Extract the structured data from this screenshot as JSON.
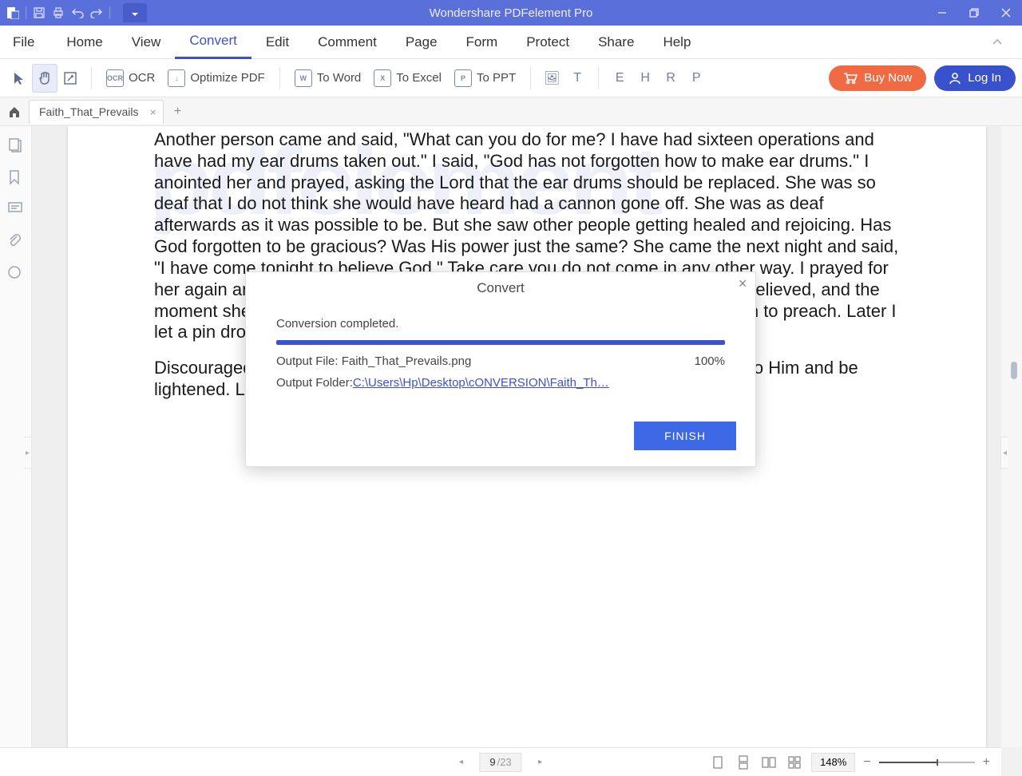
{
  "titlebar": {
    "title": "Wondershare PDFelement Pro"
  },
  "menu": {
    "file": "File",
    "items": [
      "Home",
      "View",
      "Convert",
      "Edit",
      "Comment",
      "Page",
      "Form",
      "Protect",
      "Share",
      "Help"
    ],
    "active_index": 2
  },
  "ribbon": {
    "ocr": "OCR",
    "optimize": "Optimize PDF",
    "to_word": "To Word",
    "to_excel": "To Excel",
    "to_ppt": "To PPT",
    "buy_now": "Buy Now",
    "log_in": "Log In"
  },
  "tabs": {
    "document_name": "Faith_That_Prevails"
  },
  "page_text": {
    "p1": "Another person came and said, \"What can you do for me? I have had sixteen operations and have had my ear drums taken out.\" I said, \"God has not forgotten how to make ear drums.\" I anointed her and prayed, asking the Lord that the ear drums should be replaced. She was so deaf that I do not think she would have heard had a cannon gone off. She was as deaf afterwards as it was possible to be. But she saw other people getting healed and rejoicing. Has God forgotten to be gracious? Was His power just the same? She came the next night and said, \"I have come tonight to believe God.\" Take care you do not come in any other way. I prayed for her again and commanded her ears to be loosed in the name of Jesus. She believed, and the moment she believed she heard, she ran and jumped upon a chair and began to preach. Later I let a pin drop and she heard it fall. God can give drums to ears.",
    "p2": "Discouraged one, cast your burden on the Lord. He will sustain you. Look unto Him and be lightened. Look unto Him now."
  },
  "modal": {
    "title": "Convert",
    "status": "Conversion completed.",
    "output_file_label": "Output File: ",
    "output_file_value": "Faith_That_Prevails.png",
    "percent": "100%",
    "output_folder_label": "Output  Folder: ",
    "output_folder_value": "C:\\Users\\Hp\\Desktop\\cONVERSION\\Faith_Th…",
    "finish": "FINISH"
  },
  "statusbar": {
    "page_current": "9",
    "page_total": "/23",
    "zoom": "148%"
  }
}
